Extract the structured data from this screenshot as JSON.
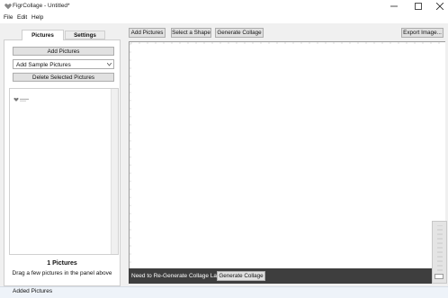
{
  "window": {
    "title": "FigrCollage - Untitled*"
  },
  "menu": {
    "file": "File",
    "edit": "Edit",
    "help": "Help"
  },
  "tabs": {
    "pictures": "Pictures",
    "settings": "Settings"
  },
  "left_panel": {
    "add_pictures": "Add Pictures",
    "sample_select": "Add Sample Pictures",
    "delete_selected": "Delete Selected Pictures",
    "count": "1 Pictures",
    "hint": "Drag a few pictures in the panel above"
  },
  "toolbar": {
    "add_pictures": "Add Pictures",
    "select_shape": "Select a Shape",
    "generate_collage": "Generate Collage",
    "export_image": "Export Image..."
  },
  "bottom_bar": {
    "message": "Need to Re-Generate Collage Layout",
    "generate_collage": "Generate Collage"
  },
  "status": {
    "text": "Added Pictures"
  },
  "colors": {
    "accent": "#3e3e3e",
    "canvas": "#ffffff",
    "chrome": "#f0f0f0"
  },
  "icons": [
    "heart-icon",
    "minimize-icon",
    "maximize-icon",
    "close-icon",
    "chevron-down-icon"
  ]
}
